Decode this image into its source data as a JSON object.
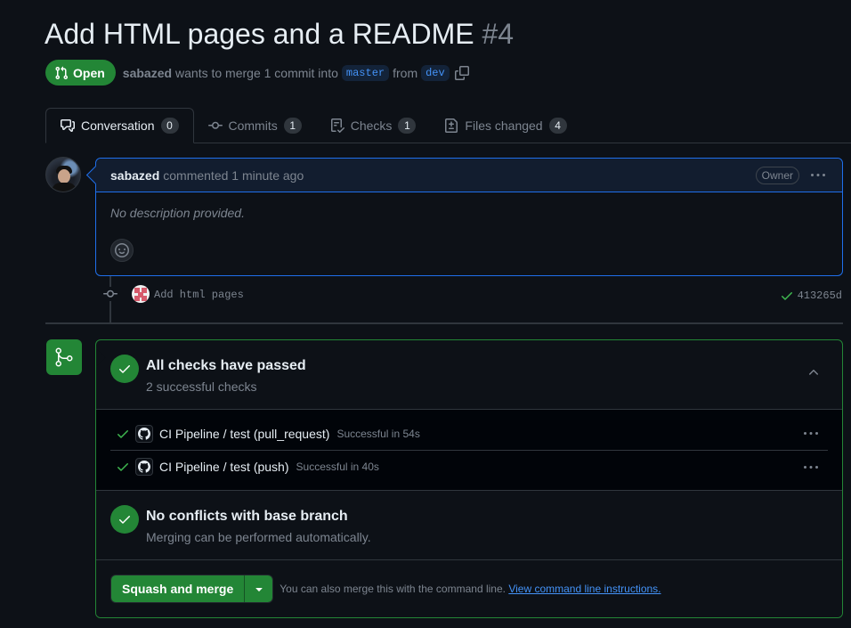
{
  "pr": {
    "title": "Add HTML pages and a README",
    "number": "#4",
    "state": "Open",
    "author": "sabazed",
    "merge_text_a": "wants to merge 1 commit into",
    "base_branch": "master",
    "from_text": "from",
    "head_branch": "dev"
  },
  "tabs": [
    {
      "label": "Conversation",
      "count": "0",
      "icon": "comment-discussion-icon"
    },
    {
      "label": "Commits",
      "count": "1",
      "icon": "git-commit-icon"
    },
    {
      "label": "Checks",
      "count": "1",
      "icon": "checklist-icon"
    },
    {
      "label": "Files changed",
      "count": "4",
      "icon": "file-diff-icon"
    }
  ],
  "comment": {
    "author": "sabazed",
    "action": "commented 1 minute ago",
    "role": "Owner",
    "body": "No description provided."
  },
  "commit": {
    "message": "Add html pages",
    "sha": "413265d"
  },
  "merge": {
    "checks_title": "All checks have passed",
    "checks_sub": "2 successful checks",
    "checks": [
      {
        "name": "CI Pipeline / test (pull_request)",
        "desc": "Successful in 54s"
      },
      {
        "name": "CI Pipeline / test (push)",
        "desc": "Successful in 40s"
      }
    ],
    "conflict_title": "No conflicts with base branch",
    "conflict_sub": "Merging can be performed automatically.",
    "button": "Squash and merge",
    "hint": "You can also merge this with the command line.",
    "hint_link": "View command line instructions."
  },
  "colors": {
    "background": "#0d1117",
    "accent_green": "#238636",
    "link_blue": "#4493f8",
    "muted": "#7d8590",
    "border": "#30363d"
  }
}
